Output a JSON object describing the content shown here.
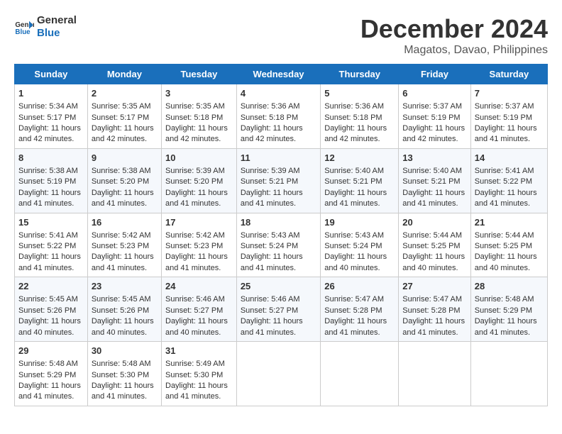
{
  "header": {
    "logo_line1": "General",
    "logo_line2": "Blue",
    "title": "December 2024",
    "subtitle": "Magatos, Davao, Philippines"
  },
  "calendar": {
    "days_of_week": [
      "Sunday",
      "Monday",
      "Tuesday",
      "Wednesday",
      "Thursday",
      "Friday",
      "Saturday"
    ],
    "weeks": [
      [
        {
          "day": "1",
          "sunrise": "5:34 AM",
          "sunset": "5:17 PM",
          "daylight": "11 hours and 42 minutes."
        },
        {
          "day": "2",
          "sunrise": "5:35 AM",
          "sunset": "5:17 PM",
          "daylight": "11 hours and 42 minutes."
        },
        {
          "day": "3",
          "sunrise": "5:35 AM",
          "sunset": "5:18 PM",
          "daylight": "11 hours and 42 minutes."
        },
        {
          "day": "4",
          "sunrise": "5:36 AM",
          "sunset": "5:18 PM",
          "daylight": "11 hours and 42 minutes."
        },
        {
          "day": "5",
          "sunrise": "5:36 AM",
          "sunset": "5:18 PM",
          "daylight": "11 hours and 42 minutes."
        },
        {
          "day": "6",
          "sunrise": "5:37 AM",
          "sunset": "5:19 PM",
          "daylight": "11 hours and 42 minutes."
        },
        {
          "day": "7",
          "sunrise": "5:37 AM",
          "sunset": "5:19 PM",
          "daylight": "11 hours and 41 minutes."
        }
      ],
      [
        {
          "day": "8",
          "sunrise": "5:38 AM",
          "sunset": "5:19 PM",
          "daylight": "11 hours and 41 minutes."
        },
        {
          "day": "9",
          "sunrise": "5:38 AM",
          "sunset": "5:20 PM",
          "daylight": "11 hours and 41 minutes."
        },
        {
          "day": "10",
          "sunrise": "5:39 AM",
          "sunset": "5:20 PM",
          "daylight": "11 hours and 41 minutes."
        },
        {
          "day": "11",
          "sunrise": "5:39 AM",
          "sunset": "5:21 PM",
          "daylight": "11 hours and 41 minutes."
        },
        {
          "day": "12",
          "sunrise": "5:40 AM",
          "sunset": "5:21 PM",
          "daylight": "11 hours and 41 minutes."
        },
        {
          "day": "13",
          "sunrise": "5:40 AM",
          "sunset": "5:21 PM",
          "daylight": "11 hours and 41 minutes."
        },
        {
          "day": "14",
          "sunrise": "5:41 AM",
          "sunset": "5:22 PM",
          "daylight": "11 hours and 41 minutes."
        }
      ],
      [
        {
          "day": "15",
          "sunrise": "5:41 AM",
          "sunset": "5:22 PM",
          "daylight": "11 hours and 41 minutes."
        },
        {
          "day": "16",
          "sunrise": "5:42 AM",
          "sunset": "5:23 PM",
          "daylight": "11 hours and 41 minutes."
        },
        {
          "day": "17",
          "sunrise": "5:42 AM",
          "sunset": "5:23 PM",
          "daylight": "11 hours and 41 minutes."
        },
        {
          "day": "18",
          "sunrise": "5:43 AM",
          "sunset": "5:24 PM",
          "daylight": "11 hours and 41 minutes."
        },
        {
          "day": "19",
          "sunrise": "5:43 AM",
          "sunset": "5:24 PM",
          "daylight": "11 hours and 40 minutes."
        },
        {
          "day": "20",
          "sunrise": "5:44 AM",
          "sunset": "5:25 PM",
          "daylight": "11 hours and 40 minutes."
        },
        {
          "day": "21",
          "sunrise": "5:44 AM",
          "sunset": "5:25 PM",
          "daylight": "11 hours and 40 minutes."
        }
      ],
      [
        {
          "day": "22",
          "sunrise": "5:45 AM",
          "sunset": "5:26 PM",
          "daylight": "11 hours and 40 minutes."
        },
        {
          "day": "23",
          "sunrise": "5:45 AM",
          "sunset": "5:26 PM",
          "daylight": "11 hours and 40 minutes."
        },
        {
          "day": "24",
          "sunrise": "5:46 AM",
          "sunset": "5:27 PM",
          "daylight": "11 hours and 40 minutes."
        },
        {
          "day": "25",
          "sunrise": "5:46 AM",
          "sunset": "5:27 PM",
          "daylight": "11 hours and 41 minutes."
        },
        {
          "day": "26",
          "sunrise": "5:47 AM",
          "sunset": "5:28 PM",
          "daylight": "11 hours and 41 minutes."
        },
        {
          "day": "27",
          "sunrise": "5:47 AM",
          "sunset": "5:28 PM",
          "daylight": "11 hours and 41 minutes."
        },
        {
          "day": "28",
          "sunrise": "5:48 AM",
          "sunset": "5:29 PM",
          "daylight": "11 hours and 41 minutes."
        }
      ],
      [
        {
          "day": "29",
          "sunrise": "5:48 AM",
          "sunset": "5:29 PM",
          "daylight": "11 hours and 41 minutes."
        },
        {
          "day": "30",
          "sunrise": "5:48 AM",
          "sunset": "5:30 PM",
          "daylight": "11 hours and 41 minutes."
        },
        {
          "day": "31",
          "sunrise": "5:49 AM",
          "sunset": "5:30 PM",
          "daylight": "11 hours and 41 minutes."
        },
        null,
        null,
        null,
        null
      ]
    ],
    "labels": {
      "sunrise": "Sunrise:",
      "sunset": "Sunset:",
      "daylight": "Daylight:"
    }
  }
}
